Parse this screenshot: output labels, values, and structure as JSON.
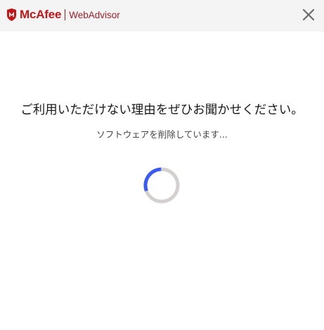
{
  "header": {
    "brand_name": "McAfee",
    "product_name": "WebAdvisor",
    "brand_color": "#c01818",
    "logo_icon": "mcafee-shield-icon",
    "close_icon": "close-icon"
  },
  "main": {
    "headline": "ご利用いただけない理由をぜひお聞かせください。",
    "status_text": "ソフトウェアを削除しています...",
    "spinner": {
      "icon": "loading-spinner-icon",
      "progress_fraction": 0.3,
      "accent_color": "#3a5bf0",
      "track_color": "#d4d0d0"
    }
  }
}
